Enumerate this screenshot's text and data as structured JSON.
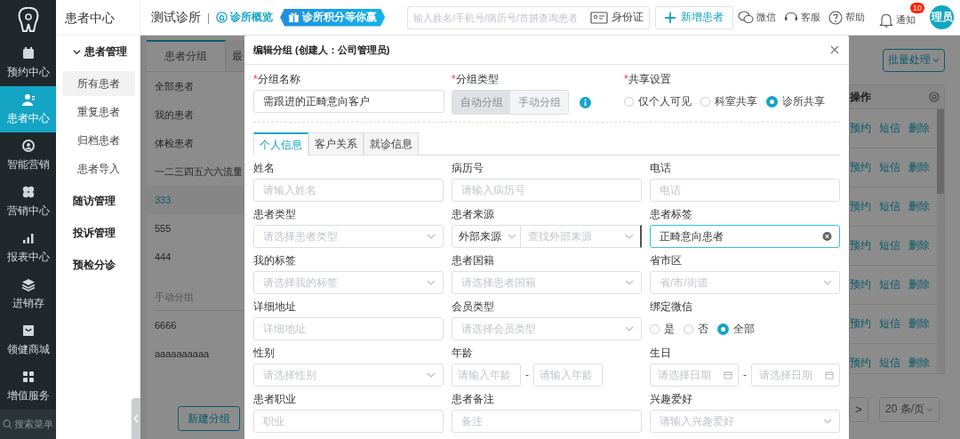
{
  "nav_rail": {
    "items": [
      {
        "label": "预约中心",
        "selected": false
      },
      {
        "label": "患者中心",
        "selected": true
      },
      {
        "label": "智能营销",
        "selected": false
      },
      {
        "label": "营销中心",
        "selected": false
      },
      {
        "label": "报表中心",
        "selected": false
      },
      {
        "label": "进销存",
        "selected": false
      },
      {
        "label": "领健商城",
        "selected": false
      },
      {
        "label": "增值服务",
        "selected": false
      }
    ],
    "search_label": "搜索菜单"
  },
  "sub_nav": {
    "title": "患者中心",
    "groups": [
      {
        "label": "患者管理",
        "expanded": true,
        "children": [
          {
            "label": "所有患者",
            "selected": true
          },
          {
            "label": "重复患者",
            "selected": false
          },
          {
            "label": "归档患者",
            "selected": false
          },
          {
            "label": "患者导入",
            "selected": false
          }
        ]
      },
      {
        "label": "随访管理"
      },
      {
        "label": "投诉管理"
      },
      {
        "label": "预检分诊"
      }
    ]
  },
  "top_bar": {
    "clinic": "测试诊所",
    "separator": "|",
    "overview_link": "诊所概览",
    "promo_banner": "诊所积分等你赢",
    "search": {
      "placeholder": "输入姓名/手机号/病历号/首拼查询患者"
    },
    "id_card_button": "身份证",
    "add_patient_button": "新增患者",
    "wechat": "微信",
    "support": "客服",
    "help": "帮助",
    "notifications": {
      "label": "通知",
      "badge": "10"
    },
    "avatar": "理员"
  },
  "page": {
    "tabs": [
      {
        "label": "患者分组",
        "selected": true
      },
      {
        "label": "最",
        "selected": false
      }
    ],
    "groups": [
      {
        "label": "全部患者",
        "selected": false
      },
      {
        "label": "我的患者",
        "selected": false
      },
      {
        "label": "体检患者",
        "selected": false
      },
      {
        "label": "一二三四五六六流量",
        "selected": false
      },
      {
        "label": "333",
        "selected": true
      },
      {
        "label": "555",
        "selected": false
      },
      {
        "label": "444",
        "selected": false
      }
    ],
    "manual_section": "手动分组",
    "manual_groups": [
      {
        "label": "6666",
        "selected": false
      },
      {
        "label": "aaaaaaaaaa",
        "selected": false
      }
    ],
    "new_group_button": "新建分组",
    "batch_button": "批量处理",
    "table": {
      "columns": [
        "操作"
      ],
      "rows": [
        {
          "actions": [
            "预约",
            "短信",
            "删除"
          ]
        },
        {
          "actions": [
            "预约",
            "短信",
            "删除"
          ]
        },
        {
          "actions": [
            "预约",
            "短信",
            "删除"
          ]
        },
        {
          "actions": [
            "预约",
            "短信",
            "删除"
          ]
        },
        {
          "actions": [
            "预约",
            "短信",
            "删除"
          ]
        },
        {
          "actions": [
            "预约",
            "短信",
            "删除"
          ]
        },
        {
          "actions": [
            "预约",
            "短信",
            "删除"
          ]
        }
      ]
    },
    "pagination": {
      "next": ">",
      "page_size": "20 条/页"
    }
  },
  "modal": {
    "title": "编辑分组 (创建人：公司管理员)",
    "group_name": {
      "label": "分组名称",
      "required_mark": "*",
      "value": "需跟进的正畸意向客户"
    },
    "group_type": {
      "label": "分组类型",
      "required_mark": "*",
      "disabled": true,
      "options": [
        {
          "label": "自动分组",
          "selected": true
        },
        {
          "label": "手动分组",
          "selected": false
        }
      ]
    },
    "share": {
      "label": "共享设置",
      "required_mark": "*",
      "options": [
        {
          "label": "仅个人可见",
          "selected": false
        },
        {
          "label": "科室共享",
          "selected": false
        },
        {
          "label": "诊所共享",
          "selected": true
        }
      ]
    },
    "tabs": [
      {
        "label": "个人信息",
        "selected": true
      },
      {
        "label": "客户关系",
        "selected": false
      },
      {
        "label": "就诊信息",
        "selected": false
      }
    ],
    "fields": [
      {
        "label": "姓名",
        "kind": "text",
        "placeholder": "请输入姓名"
      },
      {
        "label": "病历号",
        "kind": "text",
        "placeholder": "请输入病历号"
      },
      {
        "label": "电话",
        "kind": "text",
        "placeholder": "电话"
      },
      {
        "label": "患者类型",
        "kind": "select",
        "placeholder": "请选择患者类型"
      },
      {
        "label": "患者来源",
        "kind": "source",
        "value": "外部来源",
        "placeholder": "查找外部来源"
      },
      {
        "label": "患者标签",
        "kind": "tag",
        "value": "正畸意向患者",
        "focused": true
      },
      {
        "label": "我的标签",
        "kind": "select",
        "placeholder": "请选择我的标签"
      },
      {
        "label": "患者国籍",
        "kind": "select",
        "placeholder": "请选择患者国籍"
      },
      {
        "label": "省市区",
        "kind": "select",
        "placeholder": "省/市/街道"
      },
      {
        "label": "详细地址",
        "kind": "text",
        "placeholder": "详细地址"
      },
      {
        "label": "会员类型",
        "kind": "select",
        "placeholder": "请选择会员类型"
      },
      {
        "label": "绑定微信",
        "kind": "radio",
        "options": [
          {
            "label": "是",
            "selected": false
          },
          {
            "label": "否",
            "selected": false
          },
          {
            "label": "全部",
            "selected": true
          }
        ]
      },
      {
        "label": "性别",
        "kind": "select",
        "placeholder": "请选择性别"
      },
      {
        "label": "年龄",
        "kind": "range",
        "placeholders": [
          "请输入年龄",
          "请输入年龄"
        ],
        "separator": "-"
      },
      {
        "label": "生日",
        "kind": "date_range",
        "placeholders": [
          "请选择日期",
          "请选择日期"
        ],
        "separator": "-"
      },
      {
        "label": "患者职业",
        "kind": "text",
        "placeholder": "职业"
      },
      {
        "label": "患者备注",
        "kind": "text",
        "placeholder": "备注"
      },
      {
        "label": "兴趣爱好",
        "kind": "select",
        "placeholder": "请输入兴趣爱好"
      }
    ]
  }
}
